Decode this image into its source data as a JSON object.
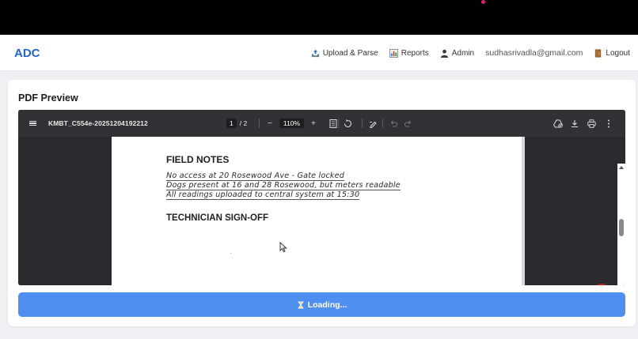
{
  "app": {
    "brand": "ADC"
  },
  "nav": {
    "upload": "Upload & Parse",
    "reports": "Reports",
    "admin": "Admin",
    "email": "sudhasrivadla@gmail.com",
    "logout": "Logout"
  },
  "card": {
    "title": "PDF Preview"
  },
  "viewer": {
    "file_name": "KMBT_C554e-20251204192212",
    "current_page": "1",
    "page_sep": "/ 2",
    "zoom": "110%",
    "minus": "−",
    "plus": "+"
  },
  "document": {
    "field_notes_heading": "FIELD NOTES",
    "note_lines": [
      "No access at 20 Rosewood Ave - Gate locked",
      "Dogs present at 16 and 28 Rosewood, but meters readable",
      "All readings uploaded to central system at 15:30"
    ],
    "signoff_heading": "TECHNICIAN SIGN-OFF"
  },
  "action": {
    "loading_label": "Loading..."
  },
  "colors": {
    "brand": "#2563c9",
    "button": "#4f8ff0",
    "viewer_bg": "#2a2a2e",
    "acrobat_red": "#d01f1f"
  }
}
